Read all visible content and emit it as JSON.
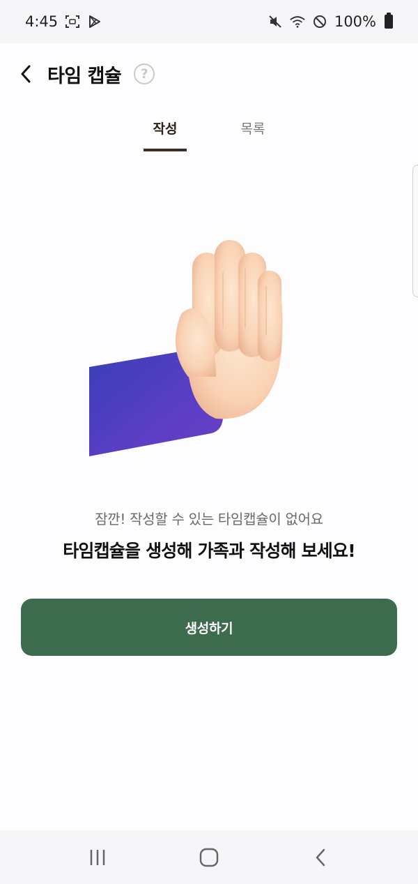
{
  "status_bar": {
    "time": "4:45",
    "battery_text": "100%",
    "icons": [
      "screenshot-icon",
      "play-store-icon",
      "mute-icon",
      "wifi-icon",
      "do-not-disturb-icon",
      "battery-icon"
    ]
  },
  "app_bar": {
    "title": "타임 캡슐",
    "help_symbol": "?",
    "icons": [
      "back-arrow-icon",
      "help-icon"
    ]
  },
  "tabs": [
    {
      "label": "작성",
      "active": true
    },
    {
      "label": "목록",
      "active": false
    }
  ],
  "empty_state": {
    "message": "잠깐! 작성할 수 있는 타임캡슐이 없어요",
    "cta": "타임캡슐을 생성해 가족과 작성해 보세요!",
    "illustration": "raised-hand-icon"
  },
  "create_button": {
    "label": "생성하기"
  },
  "nav_bar": {
    "icons": [
      "recent-apps-icon",
      "home-icon",
      "back-icon"
    ]
  },
  "colors": {
    "accent": "#3d6b4e",
    "tab_underline": "#3b2f24",
    "background": "#fdfcfe"
  }
}
